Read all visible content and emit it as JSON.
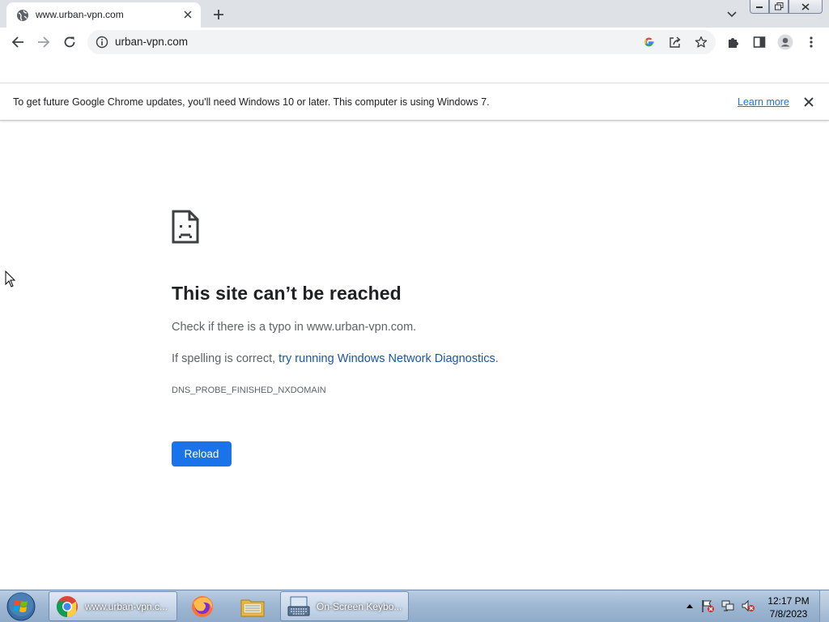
{
  "tab": {
    "title": "www.urban-vpn.com"
  },
  "omnibox": {
    "url": "urban-vpn.com"
  },
  "infobar": {
    "message": "To get future Google Chrome updates, you'll need Windows 10 or later. This computer is using Windows 7.",
    "learn_more": "Learn more"
  },
  "error": {
    "heading": "This site can’t be reached",
    "line1": "Check if there is a typo in www.urban-vpn.com.",
    "line2_prefix": "If spelling is correct, ",
    "line2_link": "try running Windows Network Diagnostics",
    "line2_suffix": ".",
    "code": "DNS_PROBE_FINISHED_NXDOMAIN",
    "reload_label": "Reload"
  },
  "taskbar": {
    "items": [
      {
        "label": "www.urban-vpn.c...",
        "icon": "chrome-icon"
      },
      {
        "label": "",
        "icon": "firefox-icon"
      },
      {
        "label": "",
        "icon": "file-explorer-icon"
      },
      {
        "label": "On-Screen Keybo...",
        "icon": "keyboard-icon"
      }
    ],
    "time": "12:17 PM",
    "date": "7/8/2023"
  },
  "colors": {
    "accent": "#1a73e8",
    "link": "#1a55a6"
  }
}
